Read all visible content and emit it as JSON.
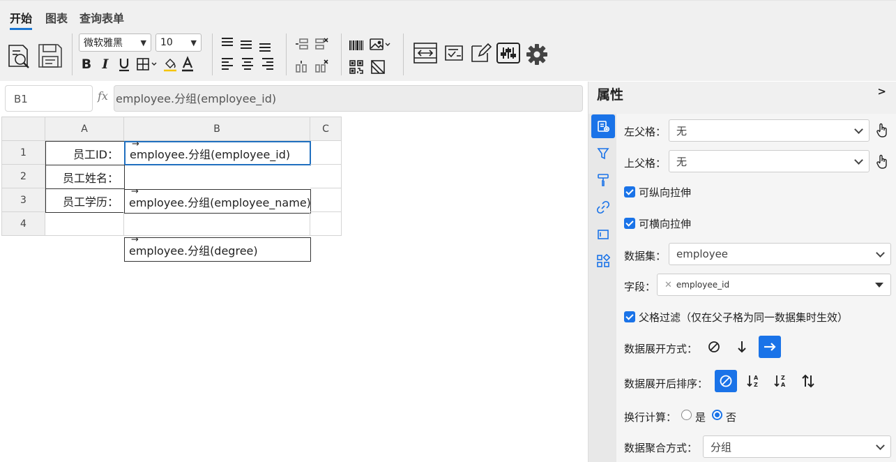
{
  "menu": {
    "tabs": [
      "开始",
      "图表",
      "查询表单"
    ],
    "active_tab": "开始"
  },
  "toolbar": {
    "font_family": "微软雅黑",
    "font_size": "10"
  },
  "formula_bar": {
    "cell_ref": "B1",
    "fx": "fx",
    "formula": "employee.分组(employee_id)"
  },
  "sheet": {
    "columns": [
      "A",
      "B",
      "C"
    ],
    "rows": [
      "1",
      "2",
      "3",
      "4"
    ],
    "labels": [
      "员工ID：",
      "员工姓名：",
      "员工学历："
    ],
    "exprs": [
      "employee.分组(employee_id)",
      "employee.分组(employee_name)",
      "employee.分组(degree)"
    ]
  },
  "panel": {
    "title": "属性",
    "collapse": ">",
    "left_parent_label": "左父格：",
    "left_parent_value": "无",
    "top_parent_label": "上父格：",
    "top_parent_value": "无",
    "vertical_stretch_label": "可纵向拉伸",
    "horizontal_stretch_label": "可横向拉伸",
    "dataset_label": "数据集：",
    "dataset_value": "employee",
    "field_label": "字段：",
    "field_tag": "employee_id",
    "parent_filter_label": "父格过滤（仅在父子格为同一数据集时生效）",
    "expand_label": "数据展开方式：",
    "sort_label": "数据展开后排序：",
    "wrap_calc_label": "换行计算：",
    "wrap_yes": "是",
    "wrap_no": "否",
    "aggregate_label": "数据聚合方式：",
    "aggregate_value": "分组"
  },
  "colors": {
    "accent": "#1a73e8"
  }
}
